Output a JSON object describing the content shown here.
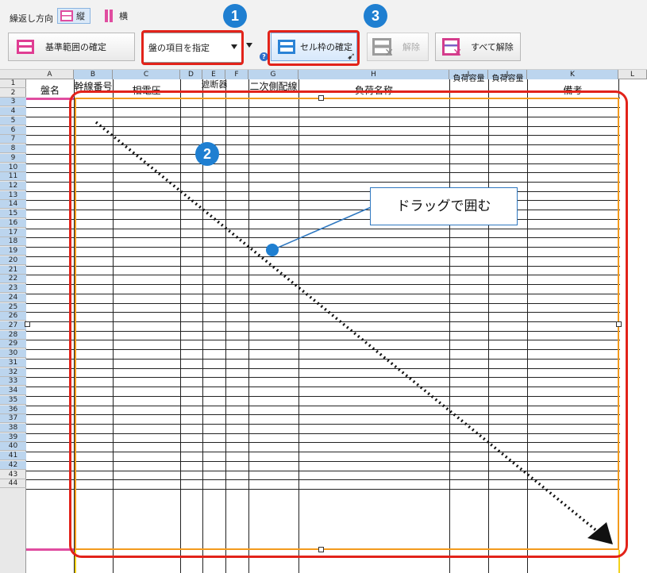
{
  "toolbar": {
    "direction_label": "繰返し方向",
    "direction_vertical": "縦",
    "direction_horizontal": "横",
    "confirm_base_label": "基準範囲の確定",
    "panel_item_select_value": "盤の項目を指定",
    "confirm_cell_label": "セル枠の確定",
    "clear_label": "解除",
    "clear_all_label": "すべて解除"
  },
  "steps": {
    "step1": "1",
    "step2": "2",
    "step3": "3"
  },
  "sheet": {
    "columns": [
      "A",
      "B",
      "C",
      "D",
      "E",
      "F",
      "G",
      "H",
      "I",
      "J",
      "K",
      "L"
    ],
    "rows": [
      "1",
      "2",
      "3",
      "4",
      "5",
      "6",
      "7",
      "8",
      "9",
      "10",
      "11",
      "12",
      "13",
      "14",
      "15",
      "16",
      "17",
      "18",
      "19",
      "20",
      "21",
      "22",
      "23",
      "24",
      "25",
      "26",
      "27",
      "28",
      "29",
      "30",
      "31",
      "32",
      "33",
      "34",
      "35",
      "36",
      "37",
      "38",
      "39",
      "40",
      "41",
      "42",
      "43",
      "44"
    ],
    "headers": {
      "panel_name": "盤名",
      "trunk_no": "幹線番号",
      "phase_voltage": "相電圧",
      "breaker": "遮断器",
      "secondary_wiring": "二次側配線",
      "load_name": "負荷名称",
      "load_capacity_1": "負荷容量",
      "load_capacity_2": "負荷容量",
      "remarks": "備考"
    }
  },
  "callout": {
    "text": "ドラッグで囲む"
  },
  "colors": {
    "highlight_red": "#e2231a",
    "step_blue": "#1f7fd1",
    "range_orange": "#f39a1c",
    "base_pink": "#e04da0"
  }
}
